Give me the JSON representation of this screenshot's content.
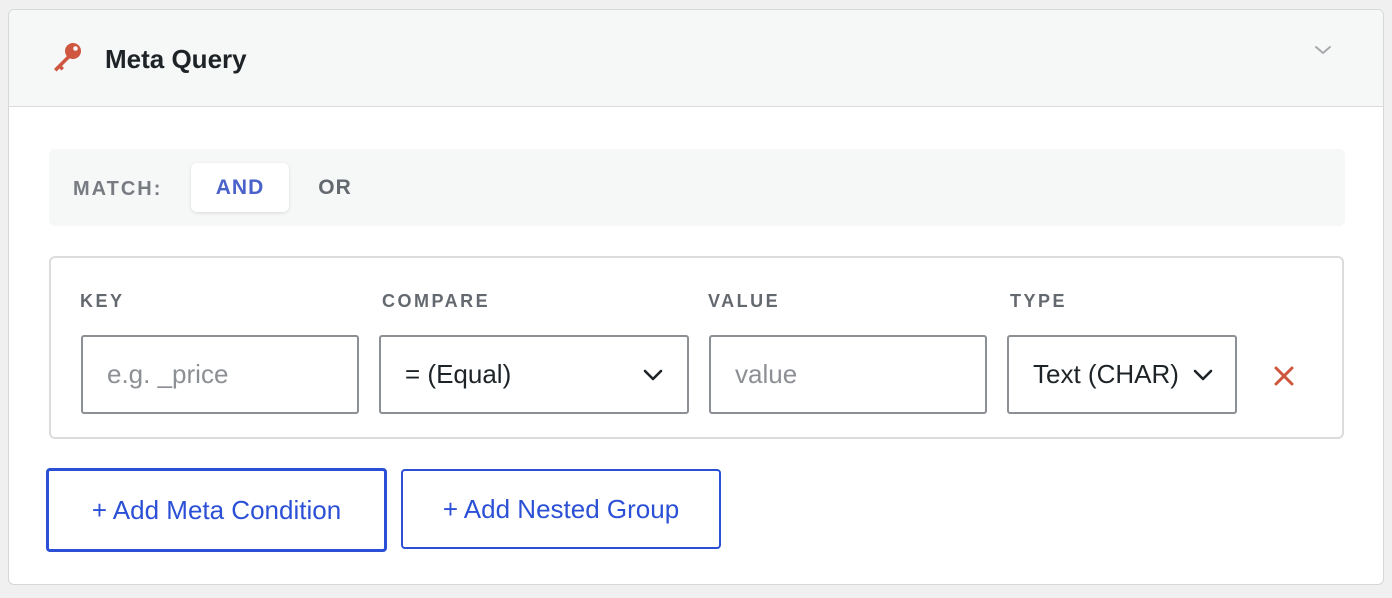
{
  "panel": {
    "title": "Meta Query",
    "icon": "key-icon",
    "toggle_icon": "chevron-down-icon",
    "colors": {
      "accent": "#2b50d6",
      "key_icon": "#d0573f",
      "remove_icon": "#d0573f",
      "match_active": "#4a62c9"
    }
  },
  "match": {
    "label": "MATCH:",
    "options": [
      {
        "label": "AND",
        "active": true
      },
      {
        "label": "OR",
        "active": false
      }
    ]
  },
  "condition": {
    "columns": {
      "key": "KEY",
      "compare": "COMPARE",
      "value": "VALUE",
      "type": "TYPE"
    },
    "key_field": {
      "value": "",
      "placeholder": "e.g. _price"
    },
    "compare_field": {
      "selected": "= (Equal)"
    },
    "value_field": {
      "value": "",
      "placeholder": "value"
    },
    "type_field": {
      "selected": "Text (CHAR)"
    },
    "remove_icon": "close-icon"
  },
  "actions": {
    "add_condition": "+ Add Meta Condition",
    "add_group": "+ Add Nested Group"
  }
}
